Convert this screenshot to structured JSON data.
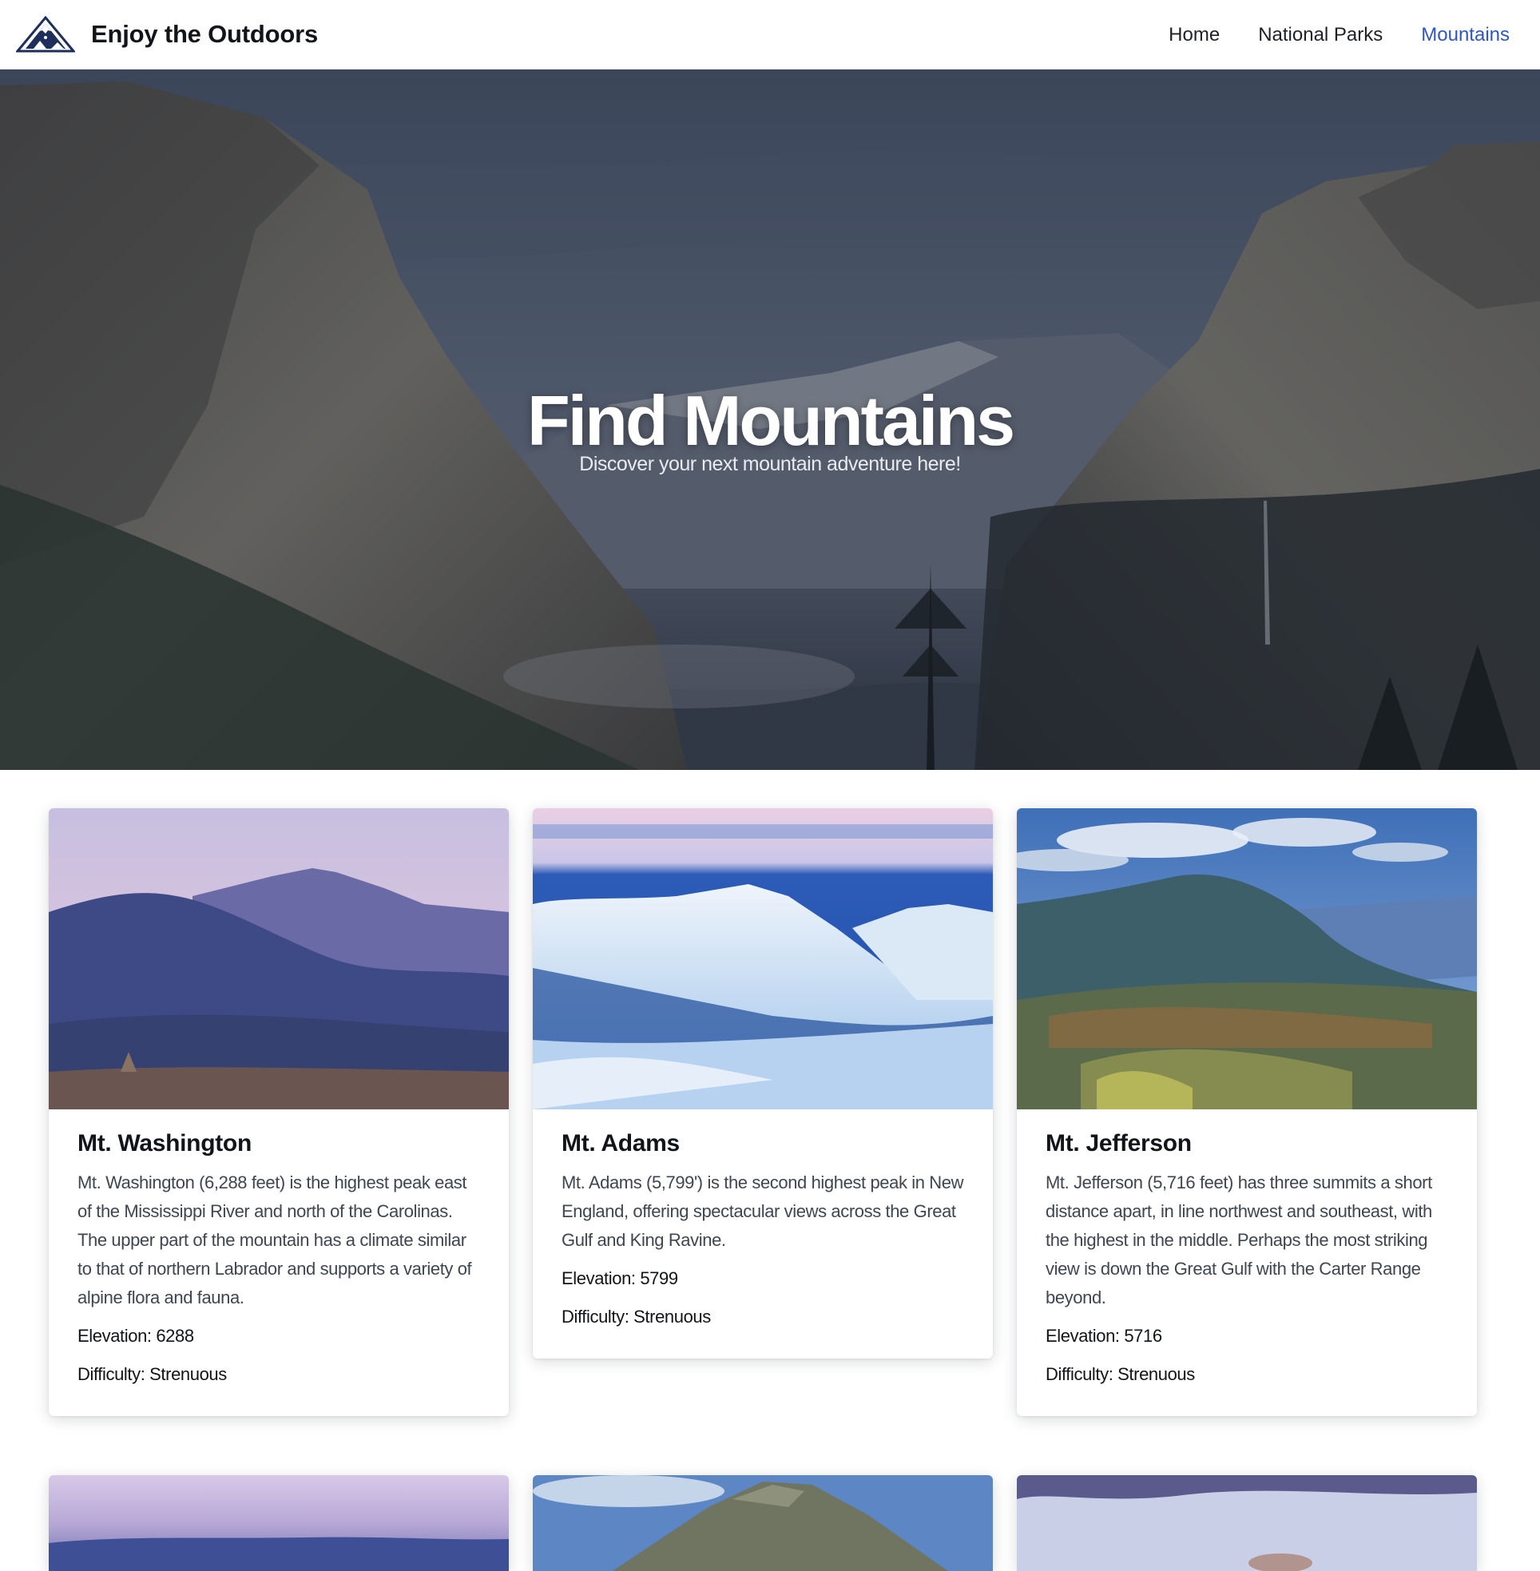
{
  "navbar": {
    "brand": "Enjoy the Outdoors",
    "links": [
      {
        "label": "Home",
        "active": false
      },
      {
        "label": "National Parks",
        "active": false
      },
      {
        "label": "Mountains",
        "active": true
      }
    ],
    "accent_color": "#2f56c9"
  },
  "hero": {
    "title": "Find Mountains",
    "subtitle": "Discover your next mountain adventure here!"
  },
  "mountains": [
    {
      "name": "Mt. Washington",
      "description": "Mt. Washington (6,288 feet) is the highest peak east of the Mississippi River and north of the Carolinas. The upper part of the mountain has a climate similar to that of northern Labrador and supports a variety of alpine flora and fauna.",
      "elevation": "Elevation: 6288",
      "difficulty": "Difficulty: Strenuous"
    },
    {
      "name": "Mt. Adams",
      "description": "Mt. Adams (5,799') is the second highest peak in New England, offering spectacular views across the Great Gulf and King Ravine.",
      "elevation": "Elevation: 5799",
      "difficulty": "Difficulty: Strenuous"
    },
    {
      "name": "Mt. Jefferson",
      "description": "Mt. Jefferson (5,716 feet) has three summits a short distance apart, in line northwest and southeast, with the highest in the middle. Perhaps the most striking view is down the Great Gulf with the Carter Range beyond.",
      "elevation": "Elevation: 5716",
      "difficulty": "Difficulty: Strenuous"
    }
  ]
}
